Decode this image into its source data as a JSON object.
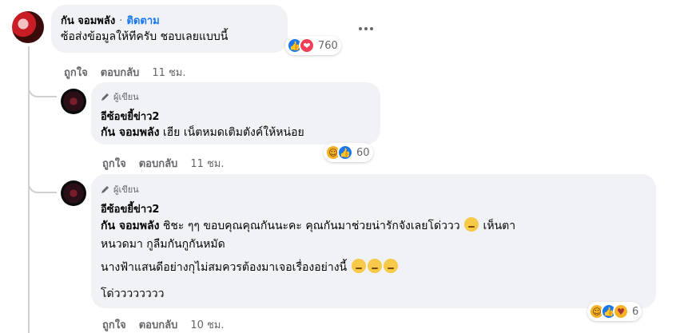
{
  "comment": {
    "author": "กัน จอมพลัง",
    "separator": "·",
    "follow_label": "ติดตาม",
    "text": "ซ้อส่งข้อมูลให้ทีครับ ชอบเลยแบบนี้",
    "reactions": {
      "icons": [
        "like-icon",
        "love-icon"
      ],
      "count": "760"
    },
    "like_label": "ถูกใจ",
    "reply_label": "ตอบกลับ",
    "time": "11 ชม."
  },
  "reply1": {
    "badge": "ผู้เขียน",
    "author": "อีซ้อขยี้ข่าว2",
    "mention": "กัน จอมพลัง",
    "text": " เฮีย เน็ตหมดเติมตังค์ให้หน่อย",
    "reactions": {
      "icons": [
        "haha-icon",
        "like-icon"
      ],
      "count": "60"
    },
    "like_label": "ถูกใจ",
    "reply_label": "ตอบกลับ",
    "time": "11 ชม."
  },
  "reply2": {
    "badge": "ผู้เขียน",
    "author": "อีซ้อขยี้ข่าว2",
    "mention": "กัน จอมพลัง",
    "line1": " ชิชะ ๆๆ ขอบคุณคุณกันนะคะ คุณกันมาช่วยน่ารักจังเลยโด่ววว",
    "line1_tail": " เห็นตา",
    "line2": "หนวดมา กูลืมกันกูกันหมัด",
    "line3": "นางฟ้าแสนดีอย่างกุไม่สมควรต้องมาเจอเรื่องอย่างนี้",
    "line4": "โด่วววววววว",
    "reactions": {
      "icons": [
        "haha-icon",
        "like-icon",
        "care-icon"
      ],
      "count": "6"
    },
    "like_label": "ถูกใจ",
    "reply_label": "ตอบกลับ",
    "time": "10 ชม."
  }
}
